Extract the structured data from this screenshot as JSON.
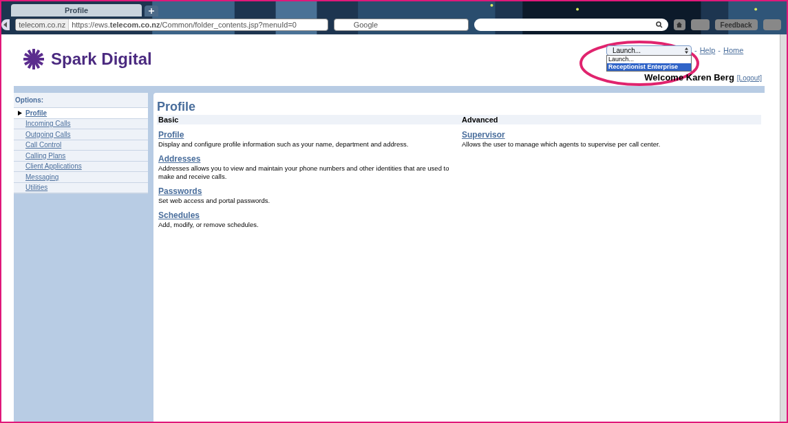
{
  "browser": {
    "tab_title": "Profile",
    "site_identity": "telecom.co.nz",
    "url": "https://ews.**telecom.co.nz**/Common/folder_contents.jsp?menuId=0",
    "search_placeholder": "Google",
    "feedback": "Feedback"
  },
  "header": {
    "logo_text": "Spark Digital",
    "launch_select": "Launch...",
    "launch_options": [
      {
        "label": "Launch...",
        "selected": false
      },
      {
        "label": "Receptionist Enterprise",
        "selected": true
      }
    ],
    "links": [
      "Help",
      "Home"
    ],
    "separator": "-",
    "welcome": "Welcome Karen Berg",
    "logout": "[Logout]"
  },
  "sidebar": {
    "title": "Options:",
    "items": [
      {
        "label": "Profile",
        "selected": true
      },
      {
        "label": "Incoming Calls",
        "selected": false
      },
      {
        "label": "Outgoing Calls",
        "selected": false
      },
      {
        "label": "Call Control",
        "selected": false
      },
      {
        "label": "Calling Plans",
        "selected": false
      },
      {
        "label": "Client Applications",
        "selected": false
      },
      {
        "label": "Messaging",
        "selected": false
      },
      {
        "label": "Utilities",
        "selected": false
      }
    ]
  },
  "main": {
    "title": "Profile",
    "columns": [
      {
        "heading": "Basic",
        "entries": [
          {
            "link": "Profile",
            "description": "Display and configure profile information such as your name, department and address."
          },
          {
            "link": "Addresses",
            "description": "Addresses allows you to view and maintain your phone numbers and other identities that are used to make and receive calls."
          },
          {
            "link": "Passwords",
            "description": "Set web access and portal passwords."
          },
          {
            "link": "Schedules",
            "description": "Add, modify, or remove schedules."
          }
        ]
      },
      {
        "heading": "Advanced",
        "entries": [
          {
            "link": "Supervisor",
            "description": "Allows the user to manage which agents to supervise per call center."
          }
        ]
      }
    ]
  }
}
